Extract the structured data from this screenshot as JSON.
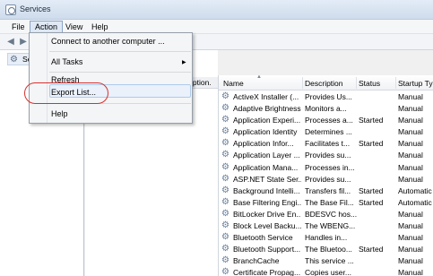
{
  "window": {
    "title": "Services"
  },
  "menubar": {
    "items": [
      "File",
      "Action",
      "View",
      "Help"
    ]
  },
  "tree": {
    "selected_label": "Se"
  },
  "middle": {
    "column_fragment": "iption."
  },
  "dropdown": {
    "items": [
      {
        "label": "Connect to another computer ...",
        "has_submenu": false
      },
      {
        "label": "All Tasks",
        "has_submenu": true
      },
      {
        "label": "Refresh",
        "has_submenu": false
      },
      {
        "label": "Export List...",
        "has_submenu": false
      },
      {
        "label": "Help",
        "has_submenu": false
      }
    ]
  },
  "list": {
    "columns": [
      "Name",
      "Description",
      "Status",
      "Startup Typ"
    ],
    "rows": [
      {
        "name": "ActiveX Installer (...",
        "description": "Provides Us...",
        "status": "",
        "startup": "Manual"
      },
      {
        "name": "Adaptive Brightness",
        "description": "Monitors a...",
        "status": "",
        "startup": "Manual"
      },
      {
        "name": "Application Experi...",
        "description": "Processes a...",
        "status": "Started",
        "startup": "Manual"
      },
      {
        "name": "Application Identity",
        "description": "Determines ...",
        "status": "",
        "startup": "Manual"
      },
      {
        "name": "Application Infor...",
        "description": "Facilitates t...",
        "status": "Started",
        "startup": "Manual"
      },
      {
        "name": "Application Layer ...",
        "description": "Provides su...",
        "status": "",
        "startup": "Manual"
      },
      {
        "name": "Application Mana...",
        "description": "Processes in...",
        "status": "",
        "startup": "Manual"
      },
      {
        "name": "ASP.NET State Ser...",
        "description": "Provides su...",
        "status": "",
        "startup": "Manual"
      },
      {
        "name": "Background Intelli...",
        "description": "Transfers fil...",
        "status": "Started",
        "startup": "Automatic"
      },
      {
        "name": "Base Filtering Engi...",
        "description": "The Base Fil...",
        "status": "Started",
        "startup": "Automatic"
      },
      {
        "name": "BitLocker Drive En...",
        "description": "BDESVC hos...",
        "status": "",
        "startup": "Manual"
      },
      {
        "name": "Block Level Backu...",
        "description": "The WBENG...",
        "status": "",
        "startup": "Manual"
      },
      {
        "name": "Bluetooth Service",
        "description": "Handles in...",
        "status": "",
        "startup": "Manual"
      },
      {
        "name": "Bluetooth Support...",
        "description": "The Bluetoo...",
        "status": "Started",
        "startup": "Manual"
      },
      {
        "name": "BranchCache",
        "description": "This service ...",
        "status": "",
        "startup": "Manual"
      },
      {
        "name": "Certificate Propag...",
        "description": "Copies user...",
        "status": "",
        "startup": "Manual"
      }
    ]
  },
  "colors": {
    "annotation": "#d9302c",
    "menu_active": "#dfe9f5"
  }
}
